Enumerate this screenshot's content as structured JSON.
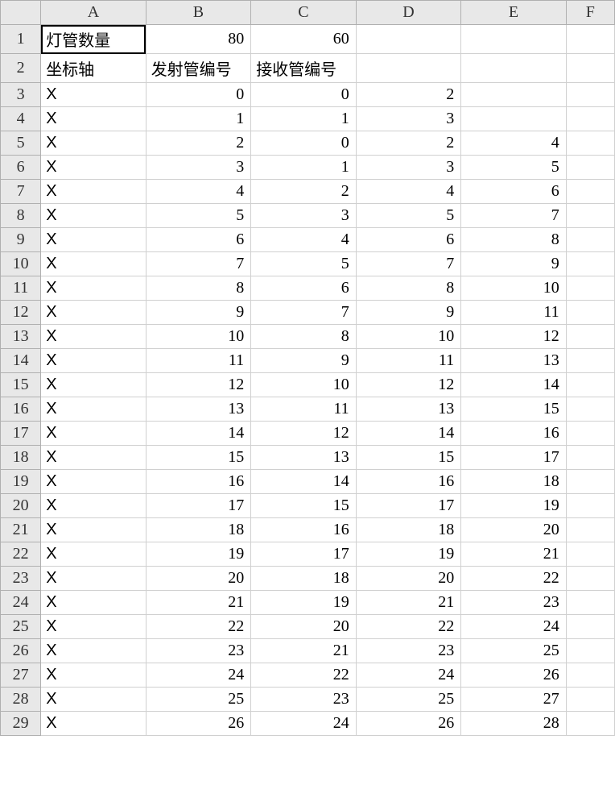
{
  "columns": [
    "A",
    "B",
    "C",
    "D",
    "E",
    "F"
  ],
  "rows": [
    {
      "num": 1,
      "cells": [
        "灯管数量",
        80,
        60,
        "",
        "",
        ""
      ]
    },
    {
      "num": 2,
      "cells": [
        "坐标轴",
        "发射管编号",
        "接收管编号",
        "",
        "",
        ""
      ]
    },
    {
      "num": 3,
      "cells": [
        "X",
        0,
        0,
        2,
        "",
        ""
      ]
    },
    {
      "num": 4,
      "cells": [
        "X",
        1,
        1,
        3,
        "",
        ""
      ]
    },
    {
      "num": 5,
      "cells": [
        "X",
        2,
        0,
        2,
        4,
        ""
      ]
    },
    {
      "num": 6,
      "cells": [
        "X",
        3,
        1,
        3,
        5,
        ""
      ]
    },
    {
      "num": 7,
      "cells": [
        "X",
        4,
        2,
        4,
        6,
        ""
      ]
    },
    {
      "num": 8,
      "cells": [
        "X",
        5,
        3,
        5,
        7,
        ""
      ]
    },
    {
      "num": 9,
      "cells": [
        "X",
        6,
        4,
        6,
        8,
        ""
      ]
    },
    {
      "num": 10,
      "cells": [
        "X",
        7,
        5,
        7,
        9,
        ""
      ]
    },
    {
      "num": 11,
      "cells": [
        "X",
        8,
        6,
        8,
        10,
        ""
      ]
    },
    {
      "num": 12,
      "cells": [
        "X",
        9,
        7,
        9,
        11,
        ""
      ]
    },
    {
      "num": 13,
      "cells": [
        "X",
        10,
        8,
        10,
        12,
        ""
      ]
    },
    {
      "num": 14,
      "cells": [
        "X",
        11,
        9,
        11,
        13,
        ""
      ]
    },
    {
      "num": 15,
      "cells": [
        "X",
        12,
        10,
        12,
        14,
        ""
      ]
    },
    {
      "num": 16,
      "cells": [
        "X",
        13,
        11,
        13,
        15,
        ""
      ]
    },
    {
      "num": 17,
      "cells": [
        "X",
        14,
        12,
        14,
        16,
        ""
      ]
    },
    {
      "num": 18,
      "cells": [
        "X",
        15,
        13,
        15,
        17,
        ""
      ]
    },
    {
      "num": 19,
      "cells": [
        "X",
        16,
        14,
        16,
        18,
        ""
      ]
    },
    {
      "num": 20,
      "cells": [
        "X",
        17,
        15,
        17,
        19,
        ""
      ]
    },
    {
      "num": 21,
      "cells": [
        "X",
        18,
        16,
        18,
        20,
        ""
      ]
    },
    {
      "num": 22,
      "cells": [
        "X",
        19,
        17,
        19,
        21,
        ""
      ]
    },
    {
      "num": 23,
      "cells": [
        "X",
        20,
        18,
        20,
        22,
        ""
      ]
    },
    {
      "num": 24,
      "cells": [
        "X",
        21,
        19,
        21,
        23,
        ""
      ]
    },
    {
      "num": 25,
      "cells": [
        "X",
        22,
        20,
        22,
        24,
        ""
      ]
    },
    {
      "num": 26,
      "cells": [
        "X",
        23,
        21,
        23,
        25,
        ""
      ]
    },
    {
      "num": 27,
      "cells": [
        "X",
        24,
        22,
        24,
        26,
        ""
      ]
    },
    {
      "num": 28,
      "cells": [
        "X",
        25,
        23,
        25,
        27,
        ""
      ]
    },
    {
      "num": 29,
      "cells": [
        "X",
        26,
        24,
        26,
        28,
        ""
      ]
    }
  ],
  "selected_cell": "A1",
  "text_headers_in_body": {
    "row1_col0": "灯管数量",
    "row2_col0": "坐标轴",
    "row2_col1": "发射管编号",
    "row2_col2": "接收管编号"
  }
}
